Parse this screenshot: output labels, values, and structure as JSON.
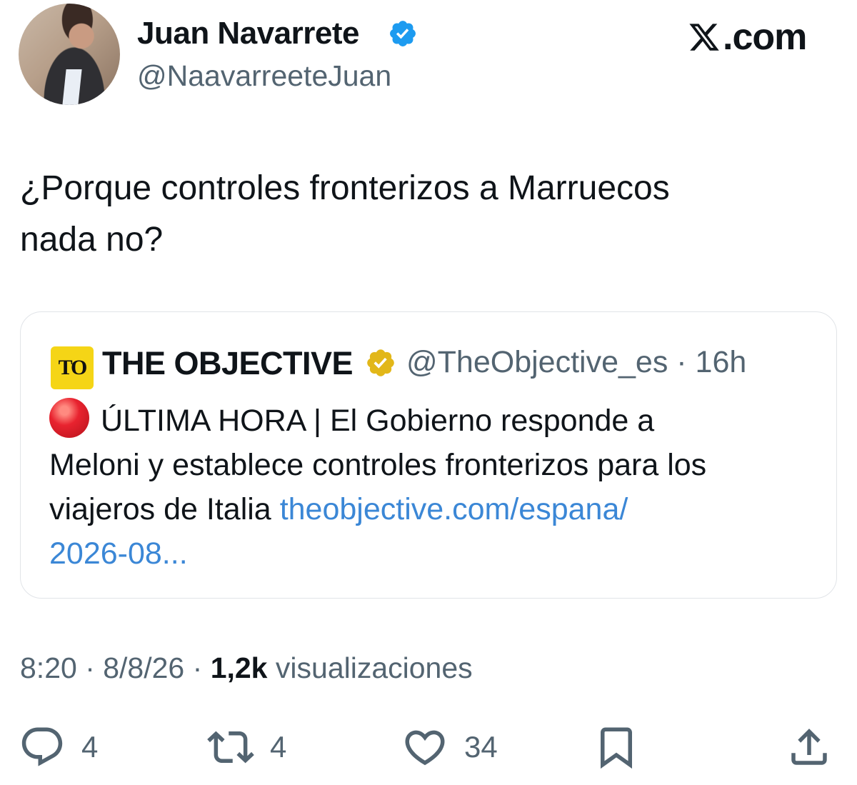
{
  "author": {
    "name": "Juan Navarrete",
    "handle": "@NaavarreeteJuan",
    "verified_color": "#1d9bf0"
  },
  "site_label": ".com",
  "tweet": {
    "line1": "¿Porque controles fronterizos a Marruecos",
    "line2": "nada no?"
  },
  "quote": {
    "logo_text": "TO",
    "name": "THE OBJECTIVE",
    "handle_time": "@TheObjective_es · 16h",
    "text_a": "ÚLTIMA HORA | El Gobierno responde a",
    "text_b": "Meloni y establece controles fronterizos para los",
    "text_c": "viajeros de Italia",
    "link_a": "theobjective.com/espana/",
    "link_b": "2026-08...",
    "verified_color": "#e2b719"
  },
  "meta": {
    "time_date": "8:20 · 8/8/26 ·",
    "views_count": "1,2k",
    "views_label": "visualizaciones"
  },
  "actions": {
    "replies": "4",
    "reposts": "4",
    "likes": "34"
  }
}
